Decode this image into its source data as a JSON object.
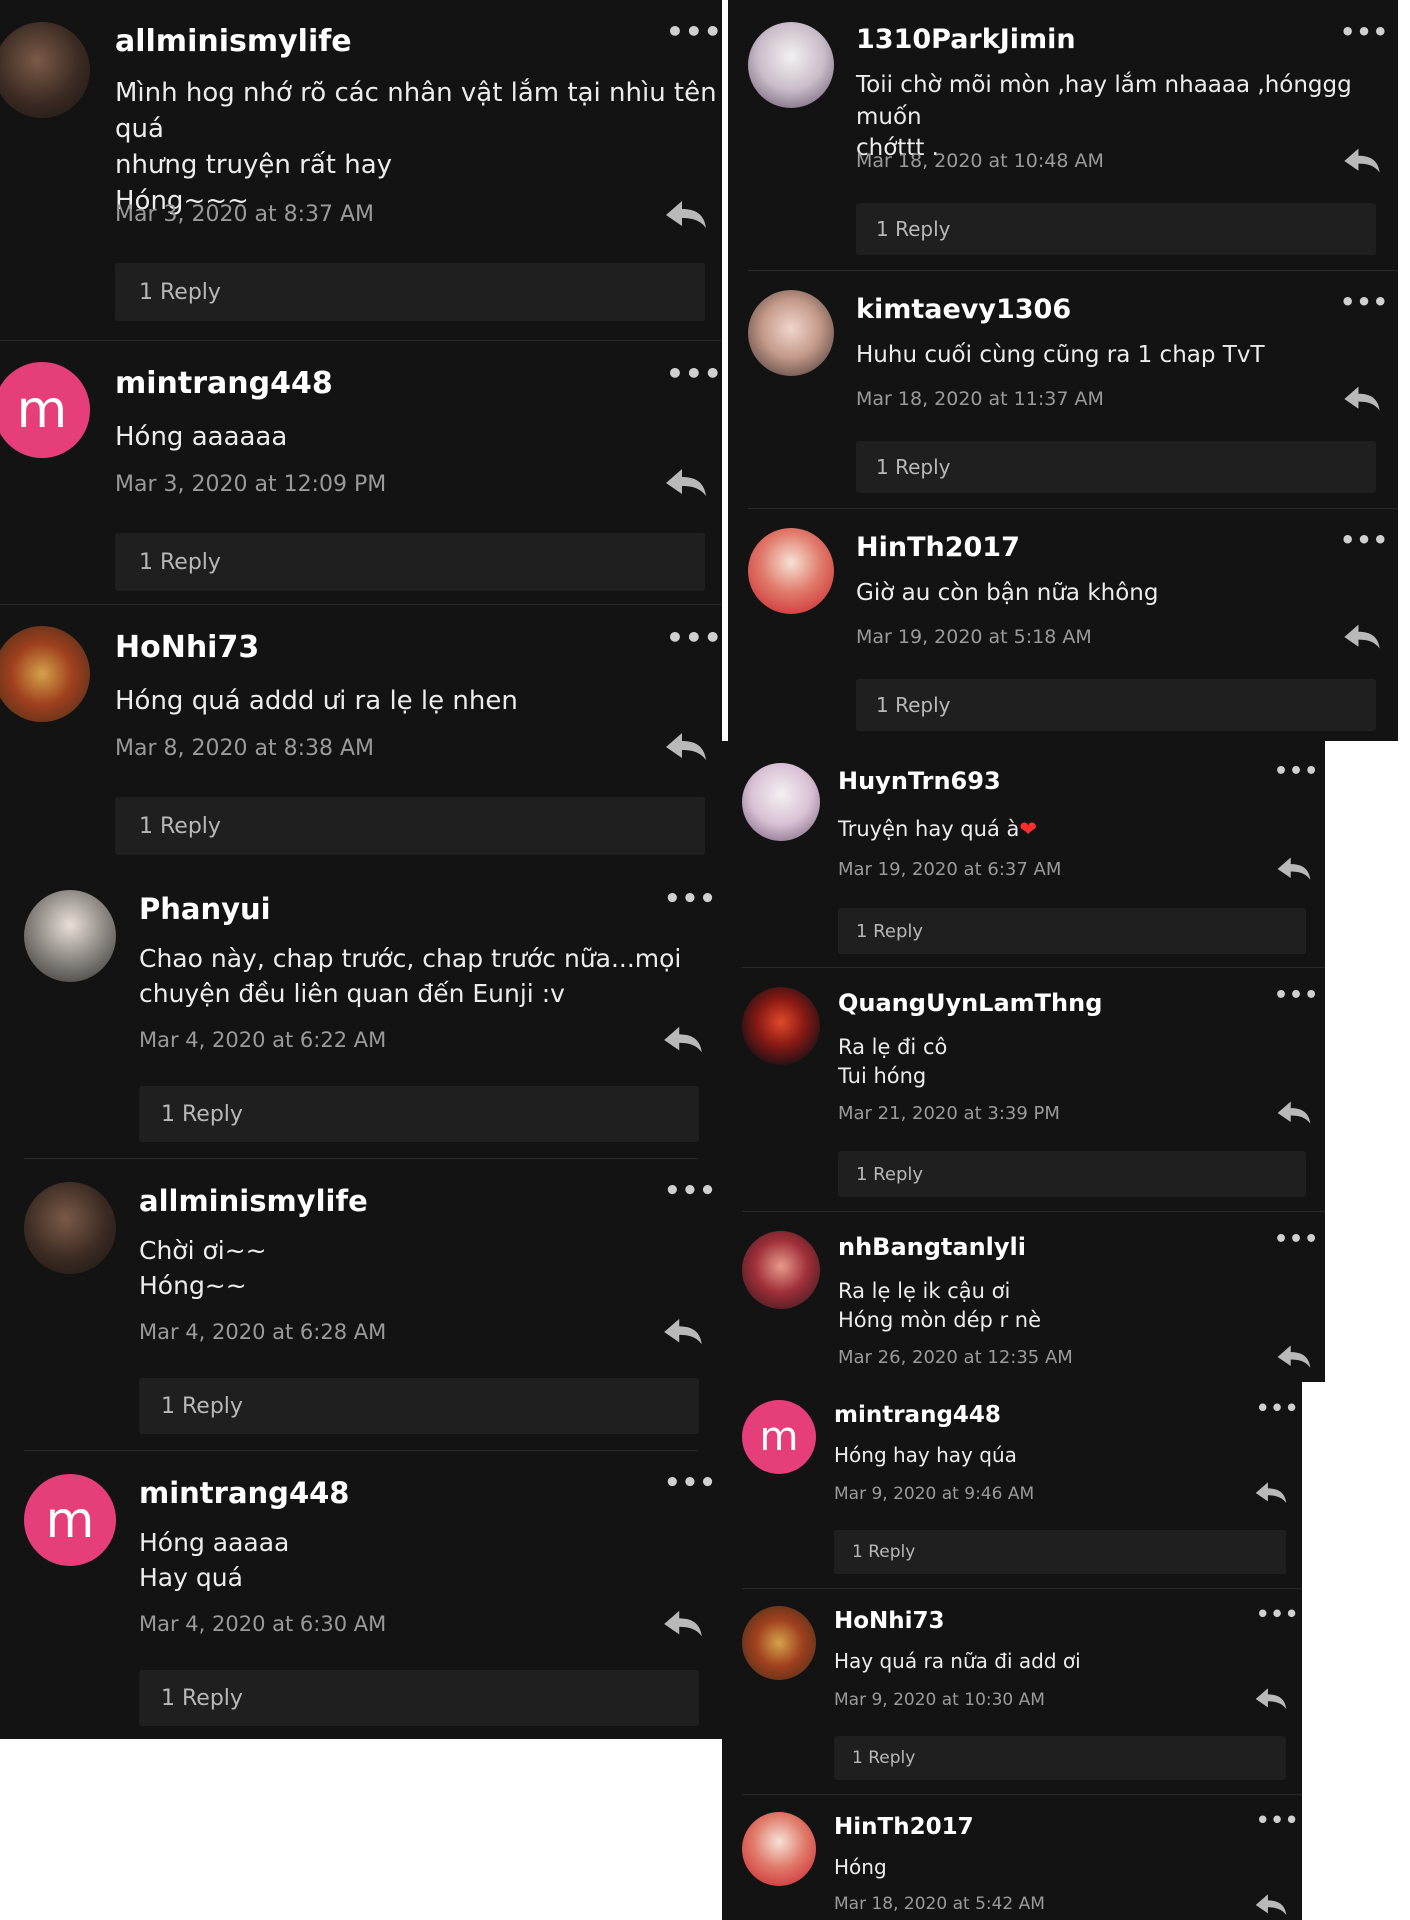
{
  "icons": {
    "more": "more-icon",
    "reply": "reply-arrow-icon",
    "heart": "heart-icon"
  },
  "colors": {
    "background": "#131313",
    "letter_avatar": "#e63e79",
    "reply_button": "#1f1f1f",
    "timestamp": "#9a9a9a"
  },
  "panels": {
    "a": [
      {
        "username": "allminismylife",
        "text": "Mình hog nhớ rõ các nhân vật lắm tại nhìu tên quá\nnhưng truyện rất hay\nHóng~~~",
        "time": "Mar 3, 2020 at 8:37 AM",
        "reply": "1 Reply",
        "avatar_letter": ""
      },
      {
        "username": "mintrang448",
        "text": "Hóng aaaaaa",
        "time": "Mar 3, 2020 at 12:09 PM",
        "reply": "1 Reply",
        "avatar_letter": "m"
      },
      {
        "username": "HoNhi73",
        "text": "Hóng quá addd ưi ra lẹ lẹ nhen",
        "time": "Mar 8, 2020 at 8:38 AM",
        "reply": "1 Reply",
        "avatar_letter": ""
      }
    ],
    "b": [
      {
        "username": "Phanyui",
        "text": "Chao này, chap trước, chap trước nữa...mọi\nchuyện đều liên quan đến Eunji :v",
        "time": "Mar 4, 2020 at 6:22 AM",
        "reply": "1 Reply",
        "avatar_letter": ""
      },
      {
        "username": "allminismylife",
        "text": "Chời ơi~~\nHóng~~",
        "time": "Mar 4, 2020 at 6:28 AM",
        "reply": "1 Reply",
        "avatar_letter": ""
      },
      {
        "username": "mintrang448",
        "text": "Hóng aaaaa\nHay quá",
        "time": "Mar 4, 2020 at 6:30 AM",
        "reply": "1 Reply",
        "avatar_letter": "m"
      }
    ],
    "c": [
      {
        "username": "1310ParkJimin",
        "text": "Toii chờ mõi mòn ,hay lắm nhaaaa ,hónggg muốn\nchớttt .",
        "time": "Mar 18, 2020 at 10:48 AM",
        "reply": "1 Reply",
        "avatar_letter": ""
      },
      {
        "username": "kimtaevy1306",
        "text": "Huhu cuối cùng cũng ra 1 chap TvT",
        "time": "Mar 18, 2020 at 11:37 AM",
        "reply": "1 Reply",
        "avatar_letter": ""
      },
      {
        "username": "HinTh2017",
        "text": "Giờ au còn bận nữa không",
        "time": "Mar 19, 2020 at 5:18 AM",
        "reply": "1 Reply",
        "avatar_letter": ""
      }
    ],
    "d": [
      {
        "username": "HuynTrn693",
        "text": "Truyện hay quá à",
        "time": "Mar 19, 2020 at 6:37 AM",
        "reply": "1 Reply",
        "avatar_letter": ""
      },
      {
        "username": "QuangUynLamThng",
        "text": "Ra lẹ đi cô\nTui hóng",
        "time": "Mar 21, 2020 at 3:39 PM",
        "reply": "1 Reply",
        "avatar_letter": ""
      },
      {
        "username": "nhBangtanlyli",
        "text": "Ra lẹ lẹ ik cậu ơi\nHóng mòn dép r nè",
        "time": "Mar 26, 2020 at 12:35 AM",
        "reply": "",
        "avatar_letter": ""
      }
    ],
    "e": [
      {
        "username": "mintrang448",
        "text": "Hóng hay hay qúa",
        "time": "Mar 9, 2020 at 9:46 AM",
        "reply": "1 Reply",
        "avatar_letter": "m"
      },
      {
        "username": "HoNhi73",
        "text": "Hay quá ra nữa đi add ơi",
        "time": "Mar 9, 2020 at 10:30 AM",
        "reply": "1 Reply",
        "avatar_letter": ""
      },
      {
        "username": "HinTh2017",
        "text": "Hóng",
        "time": "Mar 18, 2020 at 5:42 AM",
        "reply": "",
        "avatar_letter": ""
      }
    ]
  }
}
